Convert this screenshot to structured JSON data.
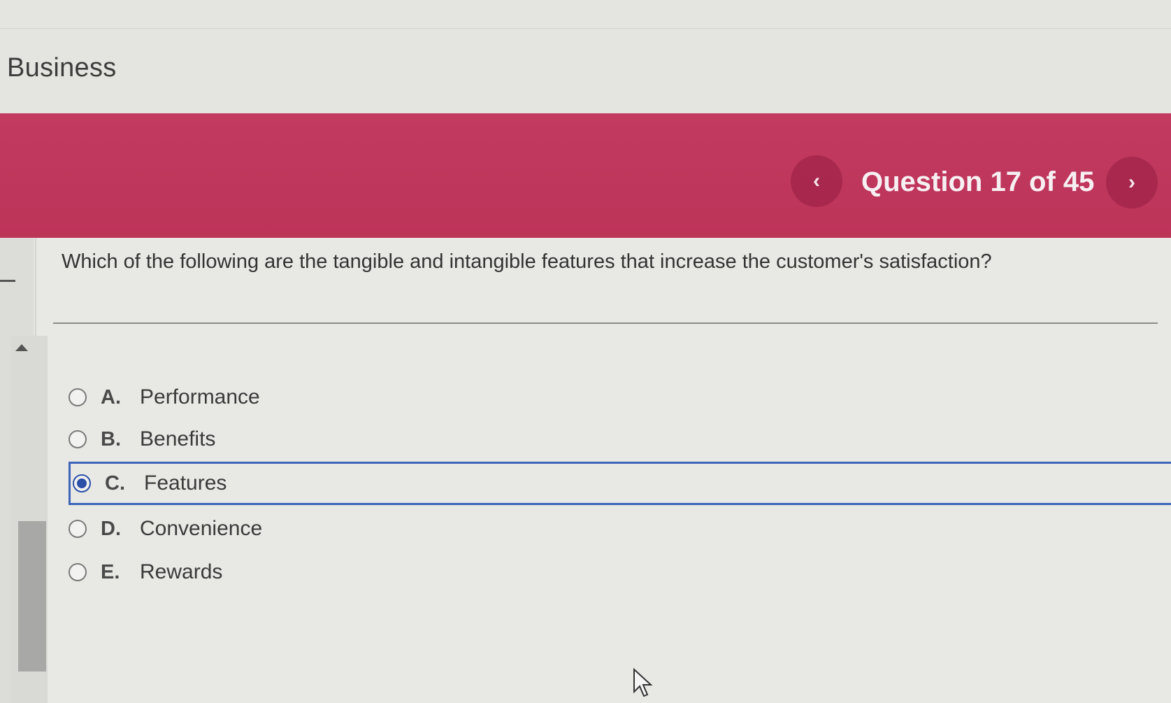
{
  "header": {
    "course_title": "Business"
  },
  "banner": {
    "counter": "Question 17 of 45",
    "prev_label": "‹",
    "next_label": "›",
    "background_color": "#c23a60"
  },
  "question": {
    "text": "Which of the following are the tangible and intangible features that increase the customer's satisfaction?"
  },
  "options": [
    {
      "letter": "A.",
      "text": "Performance",
      "selected": false
    },
    {
      "letter": "B.",
      "text": "Benefits",
      "selected": false
    },
    {
      "letter": "C.",
      "text": "Features",
      "selected": true
    },
    {
      "letter": "D.",
      "text": "Convenience",
      "selected": false
    },
    {
      "letter": "E.",
      "text": "Rewards",
      "selected": false
    }
  ],
  "colors": {
    "selection_accent": "#3d65b8"
  }
}
